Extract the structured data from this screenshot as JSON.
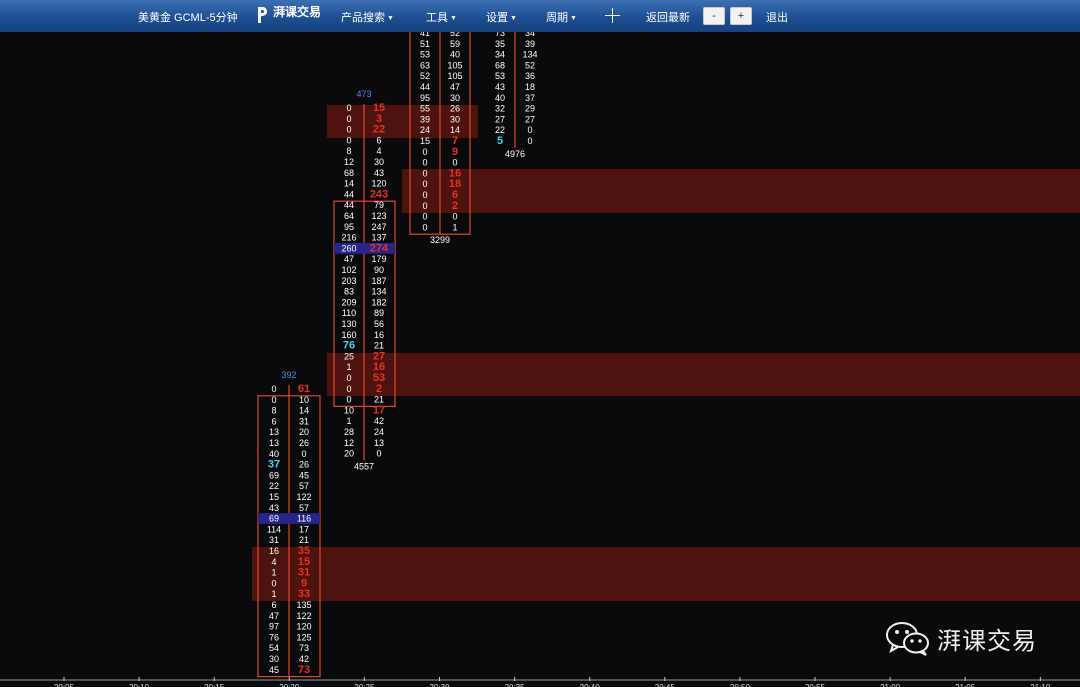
{
  "toolbar": {
    "symbol": "美黄金 GCML-5分钟",
    "logo_text": "湃课交易",
    "menu": [
      {
        "label": "产品搜索"
      },
      {
        "label": "工具"
      },
      {
        "label": "设置"
      },
      {
        "label": "周期"
      }
    ],
    "return_latest": "返回最新",
    "zoom_out": "-",
    "zoom_in": "+",
    "exit": "退出"
  },
  "watermark": {
    "text": "湃课交易",
    "icon": "wechat-icon"
  },
  "colors": {
    "background": "#0a0a0c",
    "box_border": "#d94a2c",
    "imbalance_red": "#e8321e",
    "poc_highlight": "#26268a",
    "zone_fill": "#5a1410",
    "cyan": "#3fd6e6",
    "header_blue": "#4a8ee8",
    "footer_text": "#ffffff"
  },
  "time_axis": [
    "20:05",
    "20:10",
    "20:15",
    "20:20",
    "20:25",
    "20:30",
    "20:35",
    "20:40",
    "20:45",
    "20:50",
    "20:55",
    "21:00",
    "21:05",
    "21:10"
  ],
  "chart_data": {
    "type": "table",
    "description_key": "footprint",
    "candles": [
      {
        "time": "20:20",
        "header": "392",
        "footer": "",
        "rows": [
          {
            "bid": "0",
            "ask": "61",
            "ask_red": true
          },
          {
            "bid": "0",
            "ask": "10"
          },
          {
            "bid": "8",
            "ask": "14"
          },
          {
            "bid": "6",
            "ask": "31"
          },
          {
            "bid": "13",
            "ask": "20"
          },
          {
            "bid": "13",
            "ask": "26"
          },
          {
            "bid": "40",
            "ask": "0"
          },
          {
            "bid": "37",
            "ask": "26",
            "bid_cyan": true
          },
          {
            "bid": "69",
            "ask": "45"
          },
          {
            "bid": "22",
            "ask": "57"
          },
          {
            "bid": "15",
            "ask": "122"
          },
          {
            "bid": "43",
            "ask": "57"
          },
          {
            "bid": "69",
            "ask": "116",
            "poc": true
          },
          {
            "bid": "114",
            "ask": "17"
          },
          {
            "bid": "31",
            "ask": "21"
          },
          {
            "bid": "16",
            "ask": "35",
            "ask_red": true
          },
          {
            "bid": "4",
            "ask": "15",
            "ask_red": true
          },
          {
            "bid": "1",
            "ask": "31",
            "ask_red": true
          },
          {
            "bid": "0",
            "ask": "9",
            "ask_red": true
          },
          {
            "bid": "1",
            "ask": "33",
            "ask_red": true
          },
          {
            "bid": "6",
            "ask": "135"
          },
          {
            "bid": "47",
            "ask": "122"
          },
          {
            "bid": "97",
            "ask": "120"
          },
          {
            "bid": "76",
            "ask": "125"
          },
          {
            "bid": "54",
            "ask": "73"
          },
          {
            "bid": "30",
            "ask": "42"
          },
          {
            "bid": "45",
            "ask": "73",
            "ask_red": true
          }
        ]
      },
      {
        "time": "20:25",
        "header": "473",
        "footer": "4557",
        "rows": [
          {
            "bid": "0",
            "ask": "15",
            "ask_red": true
          },
          {
            "bid": "0",
            "ask": "3",
            "ask_red": true
          },
          {
            "bid": "0",
            "ask": "22",
            "ask_red": true
          },
          {
            "bid": "0",
            "ask": "6"
          },
          {
            "bid": "8",
            "ask": "4"
          },
          {
            "bid": "12",
            "ask": "30"
          },
          {
            "bid": "68",
            "ask": "43"
          },
          {
            "bid": "14",
            "ask": "120"
          },
          {
            "bid": "44",
            "ask": "243",
            "ask_red": true
          },
          {
            "bid": "44",
            "ask": "79"
          },
          {
            "bid": "64",
            "ask": "123"
          },
          {
            "bid": "95",
            "ask": "247"
          },
          {
            "bid": "216",
            "ask": "137"
          },
          {
            "bid": "260",
            "ask": "274",
            "poc": true,
            "ask_red": true
          },
          {
            "bid": "47",
            "ask": "179"
          },
          {
            "bid": "102",
            "ask": "90"
          },
          {
            "bid": "203",
            "ask": "187"
          },
          {
            "bid": "83",
            "ask": "134"
          },
          {
            "bid": "209",
            "ask": "182"
          },
          {
            "bid": "110",
            "ask": "89"
          },
          {
            "bid": "130",
            "ask": "56"
          },
          {
            "bid": "160",
            "ask": "16"
          },
          {
            "bid": "76",
            "ask": "21",
            "bid_cyan": true
          },
          {
            "bid": "25",
            "ask": "27",
            "ask_red": true
          },
          {
            "bid": "1",
            "ask": "16",
            "ask_red": true
          },
          {
            "bid": "0",
            "ask": "53",
            "ask_red": true
          },
          {
            "bid": "0",
            "ask": "2",
            "ask_red": true
          },
          {
            "bid": "0",
            "ask": "21"
          },
          {
            "bid": "10",
            "ask": "17",
            "ask_red": true
          },
          {
            "bid": "1",
            "ask": "42"
          },
          {
            "bid": "28",
            "ask": "24"
          },
          {
            "bid": "12",
            "ask": "13"
          },
          {
            "bid": "20",
            "ask": "0"
          }
        ]
      },
      {
        "time": "20:30",
        "header": "",
        "footer": "3299",
        "rows": [
          {
            "bid": "41",
            "ask": "52"
          },
          {
            "bid": "51",
            "ask": "59"
          },
          {
            "bid": "53",
            "ask": "40"
          },
          {
            "bid": "63",
            "ask": "105"
          },
          {
            "bid": "52",
            "ask": "105"
          },
          {
            "bid": "44",
            "ask": "47"
          },
          {
            "bid": "95",
            "ask": "30"
          },
          {
            "bid": "55",
            "ask": "26"
          },
          {
            "bid": "39",
            "ask": "30"
          },
          {
            "bid": "24",
            "ask": "14"
          },
          {
            "bid": "15",
            "ask": "7",
            "ask_red": true
          },
          {
            "bid": "0",
            "ask": "9",
            "ask_red": true
          },
          {
            "bid": "0",
            "ask": "0"
          },
          {
            "bid": "0",
            "ask": "16",
            "ask_red": true
          },
          {
            "bid": "0",
            "ask": "18",
            "ask_red": true
          },
          {
            "bid": "0",
            "ask": "6",
            "ask_red": true
          },
          {
            "bid": "0",
            "ask": "2",
            "ask_red": true
          },
          {
            "bid": "0",
            "ask": "0"
          },
          {
            "bid": "0",
            "ask": "1"
          }
        ]
      },
      {
        "time": "20:35",
        "header": "",
        "footer": "4976",
        "rows": [
          {
            "bid": "73",
            "ask": "34"
          },
          {
            "bid": "35",
            "ask": "39"
          },
          {
            "bid": "34",
            "ask": "134"
          },
          {
            "bid": "68",
            "ask": "52"
          },
          {
            "bid": "53",
            "ask": "36"
          },
          {
            "bid": "43",
            "ask": "18"
          },
          {
            "bid": "40",
            "ask": "37"
          },
          {
            "bid": "32",
            "ask": "29"
          },
          {
            "bid": "27",
            "ask": "27"
          },
          {
            "bid": "22",
            "ask": "0"
          },
          {
            "bid": "5",
            "ask": "0",
            "bid_cyan": true
          }
        ]
      }
    ]
  }
}
